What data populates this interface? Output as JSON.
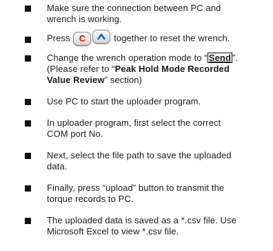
{
  "steps": [
    {
      "lines": [
        "Make sure the connection between PC and",
        "wrench is working."
      ]
    },
    {
      "prefix": "Press",
      "key_c": "C",
      "key_up_icon": "up-arrow-icon",
      "suffix": " together to reset the wrench."
    },
    {
      "line1_pre": "Change the wrench operation mode to “",
      "mode": "Send",
      "line1_post": "”.",
      "line2_pre": "(Please refer to “",
      "ref_bold_1": "Peak Hold Mode Recorded",
      "ref_bold_2": "Value Review",
      "line3_post": "” section)"
    },
    {
      "lines": [
        "Use PC to start the uploader program."
      ]
    },
    {
      "lines": [
        "In uploader program, first select the correct",
        "COM port No."
      ]
    },
    {
      "lines": [
        "Next, select the file path to save the uploaded",
        "data."
      ]
    },
    {
      "lines": [
        "Finally, press “upload” button to transmit the",
        "torque records to PC."
      ]
    },
    {
      "lines": [
        "The uploaded data is saved as a *.csv file. Use",
        "Microsoft Excel to view *.csv file."
      ]
    }
  ]
}
